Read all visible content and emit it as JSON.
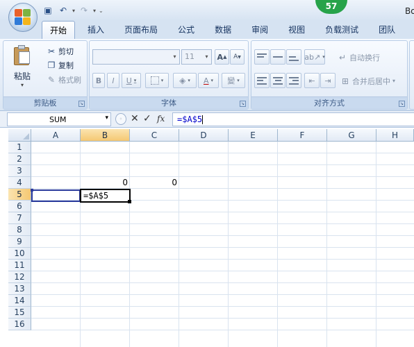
{
  "titlebar": {
    "title": "Bo",
    "badge": "57"
  },
  "quick_access": [
    {
      "name": "save-icon",
      "glyph": "💾"
    },
    {
      "name": "undo-icon",
      "glyph": "↶"
    },
    {
      "name": "redo-icon",
      "glyph": "↷"
    }
  ],
  "tabs": [
    "开始",
    "插入",
    "页面布局",
    "公式",
    "数据",
    "审阅",
    "视图",
    "负载测试",
    "团队"
  ],
  "clipboard": {
    "paste_label": "粘贴",
    "cut_label": "剪切",
    "copy_label": "复制",
    "format_painter_label": "格式刷",
    "group_label": "剪贴板"
  },
  "font": {
    "font_size": "11",
    "grow_label": "A",
    "shrink_label": "A",
    "bold_label": "B",
    "italic_label": "I",
    "underline_label": "U",
    "color_label": "A",
    "phonetic_label": "變",
    "group_label": "字体"
  },
  "alignment": {
    "wrap_text_label": "自动换行",
    "merge_center_label": "合并后居中",
    "group_label": "对齐方式"
  },
  "formula_bar": {
    "name_box": "SUM",
    "cancel_glyph": "✕",
    "enter_glyph": "✓",
    "fx_label": "fx",
    "formula": "=$A$5"
  },
  "grid": {
    "columns": [
      "A",
      "B",
      "C",
      "D",
      "E",
      "F",
      "G",
      "H"
    ],
    "selected_column": "B",
    "rows": [
      "1",
      "2",
      "3",
      "4",
      "5",
      "6",
      "7",
      "8",
      "9",
      "10",
      "11",
      "12",
      "13",
      "14",
      "15",
      "16"
    ],
    "selected_row": "5",
    "cells": {
      "B4": "0",
      "C4": "0",
      "B5": "=$A$5"
    }
  },
  "colors": {
    "accent": "#2a3a9c",
    "header_highlight": "#f5c872",
    "ribbon_bg": "#dce7f4",
    "badge": "#27a34a",
    "formula_text": "#0000cc"
  }
}
